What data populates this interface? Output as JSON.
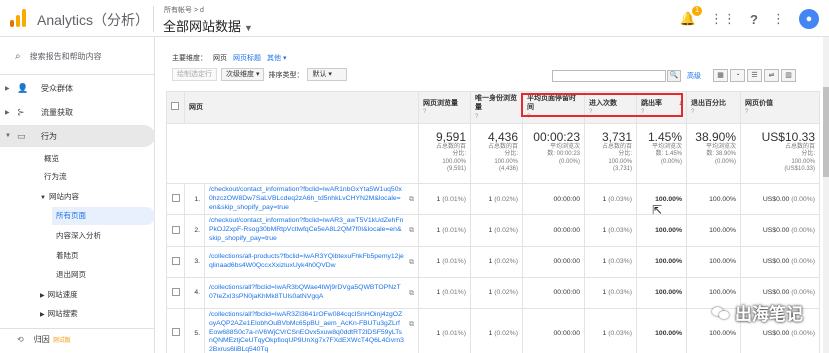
{
  "app": {
    "title": "Analytics（分析）"
  },
  "header": {
    "breadcrumb": "所有帐号 > d",
    "view_title": "全部网站数据",
    "notification_count": "1"
  },
  "sidebar": {
    "search_placeholder": "搜索报告和帮助内容",
    "items": [
      {
        "label": "受众群体",
        "icon": "person-icon"
      },
      {
        "label": "流量获取",
        "icon": "acquisition-icon"
      },
      {
        "label": "行为",
        "icon": "behavior-icon"
      }
    ],
    "behavior_children": [
      "概览",
      "行为流"
    ],
    "site_content": "网站内容",
    "site_content_children": [
      "所有页面",
      "内容深入分析",
      "着陆页",
      "退出网页"
    ],
    "more": [
      "网站速度",
      "网站搜索"
    ],
    "attribution": "归因",
    "beta": "测试版"
  },
  "main": {
    "dimension_label": "主要维度：",
    "dimension_page": "网页",
    "dimension_title": "网页标题",
    "dimension_other": "其他",
    "toolbar": {
      "plot_rows": "绘制选定行",
      "secondary_dim": "次级维度",
      "sort_type_label": "排序类型：",
      "sort_default": "默认"
    },
    "advanced": "高级"
  },
  "table": {
    "headers": {
      "page": "网页",
      "pageviews": "网页浏览量",
      "unique": "唯一身份浏览量",
      "avg_time": "平均页面停留时间",
      "entrances": "进入次数",
      "bounce": "跳出率",
      "exit": "退出百分比",
      "value": "网页价值"
    },
    "totals": {
      "pageviews": "9,591",
      "pageviews_sub": [
        "占总数的百",
        "分比:",
        "100.00%",
        "(9,591)"
      ],
      "unique": "4,436",
      "unique_sub": [
        "占总数的百",
        "分比:",
        "100.00%",
        "(4,436)"
      ],
      "avg_time": "00:00:23",
      "avg_time_sub": [
        "平均浏览次",
        "数: 00:00:23",
        "(0.00%)"
      ],
      "entrances": "3,731",
      "entrances_sub": [
        "占总数的百",
        "分比:",
        "100.00%",
        "(3,731)"
      ],
      "bounce": "1.45%",
      "bounce_sub": [
        "平均浏览次",
        "数: 1.45%",
        "(0.00%)"
      ],
      "exit": "38.90%",
      "exit_sub": [
        "平均浏览次",
        "数: 38.90%",
        "(0.00%)"
      ],
      "value": "US$10.33",
      "value_sub": [
        "占总数的百",
        "分比:",
        "100.00%",
        "(US$10.33)"
      ]
    },
    "rows": [
      {
        "idx": "1.",
        "page": "/checkout/contact_information?fbclid=IwAR1nbGxYta5W1uq50x0hzczOW8Dw7SaLVBLcdeq2zA6h_td5nhkLvCHYN2M&locale=en&skip_shopify_pay=true",
        "pv": "1",
        "pv_pct": "(0.01%)",
        "upv": "1",
        "upv_pct": "(0.02%)",
        "avg": "00:00:00",
        "ent": "1",
        "ent_pct": "(0.03%)",
        "bounce": "100.00%",
        "exit": "100.00%",
        "value": "US$0.00",
        "value_pct": "(0.00%)"
      },
      {
        "idx": "2.",
        "page": "/checkout/contact_information?fbclid=IwAR3_awT5V1kUdZehFnPkOJZxpF-Rsog30bMRtpVctlwfqCe5eA8L2QM7f0I&locale=en&skip_shopify_pay=true",
        "pv": "1",
        "pv_pct": "(0.01%)",
        "upv": "1",
        "upv_pct": "(0.02%)",
        "avg": "00:00:00",
        "ent": "1",
        "ent_pct": "(0.03%)",
        "bounce": "100.00%",
        "exit": "100.00%",
        "value": "US$0.00",
        "value_pct": "(0.00%)"
      },
      {
        "idx": "3.",
        "page": "/collections/all-products?fbclid=IwAR3YQibtexuFhkFb5pemy12jeqlinaad6bs4W0QccxXxizluxUyk4h0QVDw",
        "pv": "1",
        "pv_pct": "(0.01%)",
        "upv": "1",
        "upv_pct": "(0.02%)",
        "avg": "00:00:00",
        "ent": "1",
        "ent_pct": "(0.03%)",
        "bounce": "100.00%",
        "exit": "100.00%",
        "value": "US$0.00",
        "value_pct": "(0.00%)"
      },
      {
        "idx": "4.",
        "page": "/collections/all?fbclid=IwAR3bQWae4tWj9rDVga5QWBTOPNzT07teZxI3sPN0jaKhMk8TUls0atNVgqA",
        "pv": "1",
        "pv_pct": "(0.01%)",
        "upv": "1",
        "upv_pct": "(0.02%)",
        "avg": "00:00:00",
        "ent": "1",
        "ent_pct": "(0.03%)",
        "bounce": "100.00%",
        "exit": "100.00%",
        "value": "US$0.00",
        "value_pct": "(0.00%)"
      },
      {
        "idx": "5.",
        "page": "/collections/all?fbclid=IwAR3ZI3641rOFw084cqcISnHOinj4zgOZoyAQP2AZe1ElobhOuBVbMc65pBU_aem_AcKn-FBUTu3gZLrfEow688S0c7a-nV6WjCVrCSnEOvx5xuw8q0ddtRT2lDSF59yLTsnQNMEztjCeUTqyOkpfioqUP9UnXg7x7FXdEXWcT4Q6L4Gvrn32Bxrus6liBLq540Tq",
        "pv": "1",
        "pv_pct": "(0.01%)",
        "upv": "1",
        "upv_pct": "(0.02%)",
        "avg": "00:00:00",
        "ent": "1",
        "ent_pct": "(0.03%)",
        "bounce": "100.00%",
        "exit": "100.00%",
        "value": "US$0.00",
        "value_pct": "(0.00%)"
      }
    ]
  },
  "watermark": "出海笔记",
  "colors": {
    "accent": "#1a73e8",
    "highlight": "#e32b2b",
    "logo_orange": "#f9ab00",
    "logo_dark": "#e37400"
  }
}
